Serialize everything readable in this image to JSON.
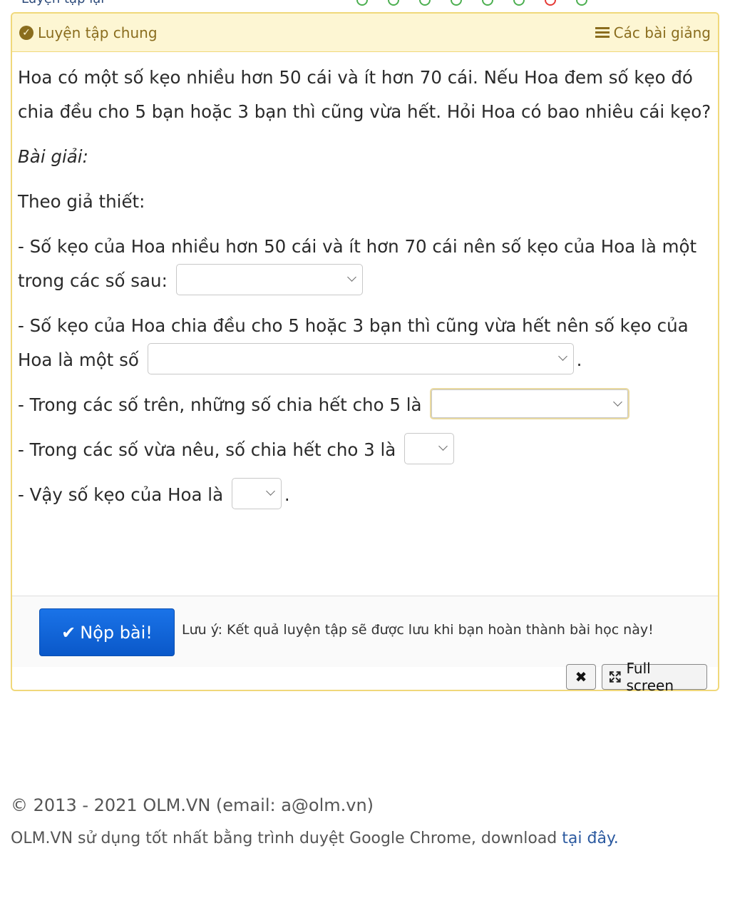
{
  "top": {
    "retry_label": "Luyện tập lại"
  },
  "header": {
    "title": "Luyện tập chung",
    "lessons_link": "Các bài giảng"
  },
  "question": {
    "text": "Hoa có một số kẹo nhiều hơn 50 cái và ít hơn 70 cái. Nếu Hoa đem số kẹo đó chia đều cho 5 bạn hoặc 3 bạn thì cũng vừa hết. Hỏi Hoa có bao nhiêu cái kẹo?",
    "solution_label": "Bài giải:",
    "premise": "Theo giả thiết:",
    "line1": "-  Số kẹo của Hoa nhiều hơn 50 cái và ít hơn 70 cái nên số kẹo của Hoa là một trong các số sau:",
    "line2": "- Số kẹo của Hoa chia đều cho 5 hoặc 3 bạn thì cũng vừa hết nên số kẹo của Hoa là một số",
    "line2_end": ".",
    "line3": "- Trong các số trên, những số chia hết cho 5 là",
    "line4": "- Trong các số vừa nêu, số chia hết cho 3 là",
    "line5": "- Vậy số kẹo của Hoa là",
    "line5_end": "."
  },
  "actions": {
    "submit_label": "Nộp bài!",
    "note": "Lưu ý: Kết quả luyện tập sẽ được lưu khi bạn hoàn thành bài học này!",
    "close_label": "✖",
    "fullscreen_label": "Full screen"
  },
  "footer": {
    "copyright": "© 2013 - 2021 OLM.VN (email: a@olm.vn)",
    "browser_note": "OLM.VN sử dụng tốt nhất bằng trình duyệt Google Chrome, download ",
    "download_link": "tại đây."
  },
  "colors": {
    "header_bg": "#fdf6d3",
    "header_text": "#8a6d1e",
    "panel_border": "#f0d87a",
    "submit_bg": "#1a73e8"
  }
}
